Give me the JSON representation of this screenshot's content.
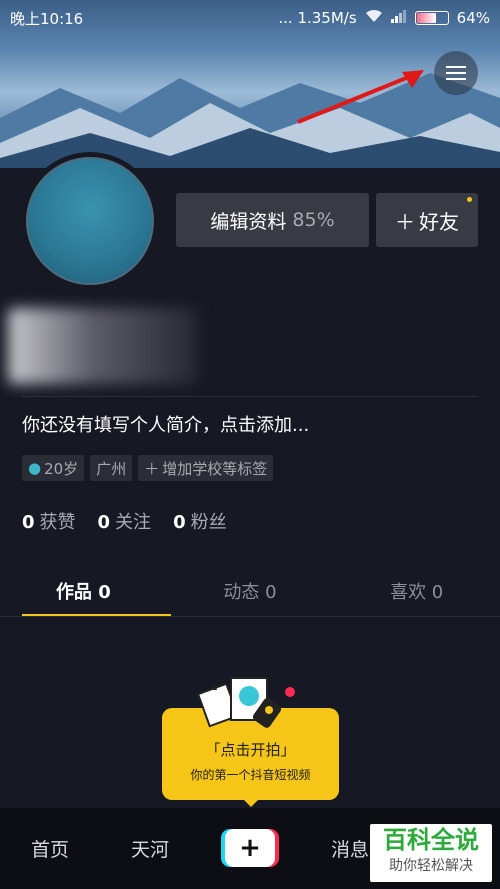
{
  "status_bar": {
    "time": "晚上10:16",
    "network": "... 1.35M/s",
    "battery": "64%"
  },
  "profile": {
    "edit_label": "编辑资料",
    "edit_pct": "85%",
    "friend_label": "好友",
    "bio": "你还没有填写个人简介，点击添加...",
    "tags": [
      {
        "icon": "person-icon",
        "label": "20岁"
      },
      {
        "label": "广州"
      },
      {
        "icon": "plus-icon",
        "label": "增加学校等标签"
      }
    ],
    "stats": [
      {
        "num": "0",
        "label": "获赞"
      },
      {
        "num": "0",
        "label": "关注"
      },
      {
        "num": "0",
        "label": "粉丝"
      }
    ]
  },
  "tabs": [
    {
      "label": "作品 0",
      "active": true
    },
    {
      "label": "动态 0",
      "active": false
    },
    {
      "label": "喜欢 0",
      "active": false
    }
  ],
  "prompt": {
    "title": "「点击开拍」",
    "subtitle": "你的第一个抖音短视频"
  },
  "bottom_nav": [
    "首页",
    "天河",
    "消息"
  ],
  "watermark": {
    "title": "百科全说",
    "subtitle": "助你轻松解决"
  },
  "colors": {
    "accent": "#f5c518",
    "background": "#161823",
    "button": "#393b44"
  }
}
